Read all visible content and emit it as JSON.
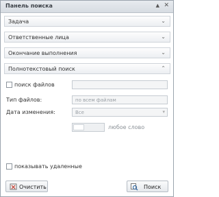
{
  "window": {
    "title": "Панель поиска",
    "pin_icon": "pin-icon",
    "close_icon": "close-icon"
  },
  "sections": [
    {
      "label": "Задача",
      "state": "collapsed"
    },
    {
      "label": "Ответственные лица",
      "state": "collapsed"
    },
    {
      "label": "Окончание выполнения",
      "state": "collapsed"
    },
    {
      "label": "Полнотекстовый поиск",
      "state": "expanded"
    }
  ],
  "fulltext": {
    "file_search_label": "поиск файлов",
    "file_search_checked": false,
    "search_value": "",
    "file_type_label": "Тип файлов:",
    "file_type_placeholder": "по всем файлам",
    "date_label": "Дата изменения:",
    "date_value": "Все",
    "any_word_label": "любое слово"
  },
  "footer": {
    "show_deleted_label": "показывать удаленные",
    "show_deleted_checked": false,
    "clear_label": "Очистить",
    "search_label": "Поиск"
  },
  "colors": {
    "titlebar": "#d7dce2",
    "border": "#9aa3ad",
    "panel": "#eceff2"
  }
}
